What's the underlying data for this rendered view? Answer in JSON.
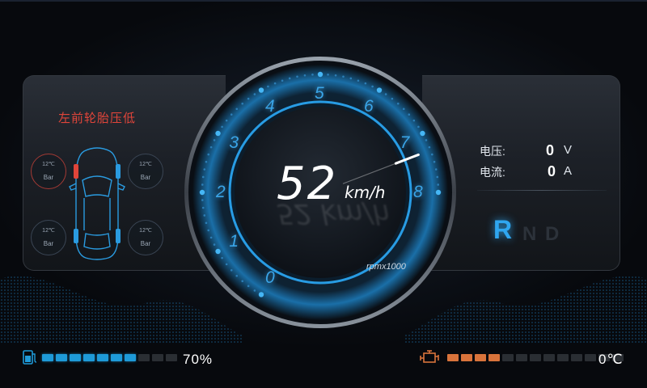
{
  "tires": {
    "warning": "左前轮胎压低",
    "front_left": {
      "temp": "12℃",
      "unit": "Bar"
    },
    "front_right": {
      "temp": "12℃",
      "unit": "Bar"
    },
    "rear_left": {
      "temp": "12℃",
      "unit": "Bar"
    },
    "rear_right": {
      "temp": "12℃",
      "unit": "Bar"
    }
  },
  "speedometer": {
    "speed": "52",
    "unit": "km/h",
    "rpm_label": "rpmx1000",
    "scale": [
      "0",
      "1",
      "2",
      "3",
      "4",
      "5",
      "6",
      "7",
      "8"
    ],
    "needle_rpm": 7.3
  },
  "electrical": {
    "voltage_label": "电压:",
    "voltage_value": "0",
    "voltage_unit": "V",
    "current_label": "电流:",
    "current_value": "0",
    "current_unit": "A"
  },
  "gears": {
    "options": [
      "R",
      "N",
      "D"
    ],
    "active": "R"
  },
  "battery": {
    "percent": "70%",
    "level_fraction": 0.7,
    "segments": 10
  },
  "temperature": {
    "value": "0℃",
    "level_segments": 4,
    "segments": 13
  },
  "colors": {
    "accent": "#2fa6f0",
    "warning": "#e0453a",
    "engine": "#d9733b"
  }
}
